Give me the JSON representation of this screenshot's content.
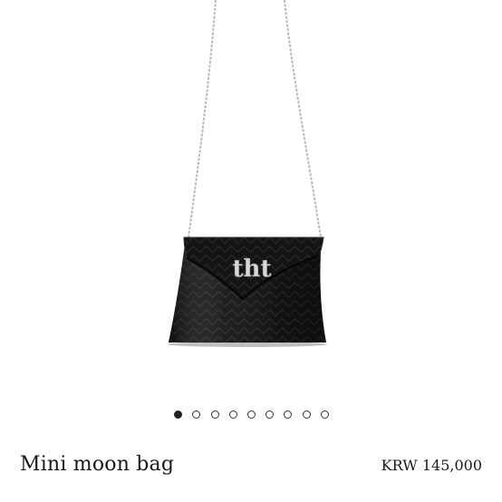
{
  "product": {
    "name": "Mini moon bag",
    "price": "KRW 145,000",
    "logo_text": "tht",
    "image": {
      "subject": "black-croc-embossed-mini-bag-with-silver-chain",
      "bag_color": "#141414",
      "chain_color": "#b9b9b9"
    }
  },
  "carousel": {
    "total": 9,
    "active_index": 0,
    "active_color": "#222222",
    "inactive_color": "#ffffff"
  }
}
